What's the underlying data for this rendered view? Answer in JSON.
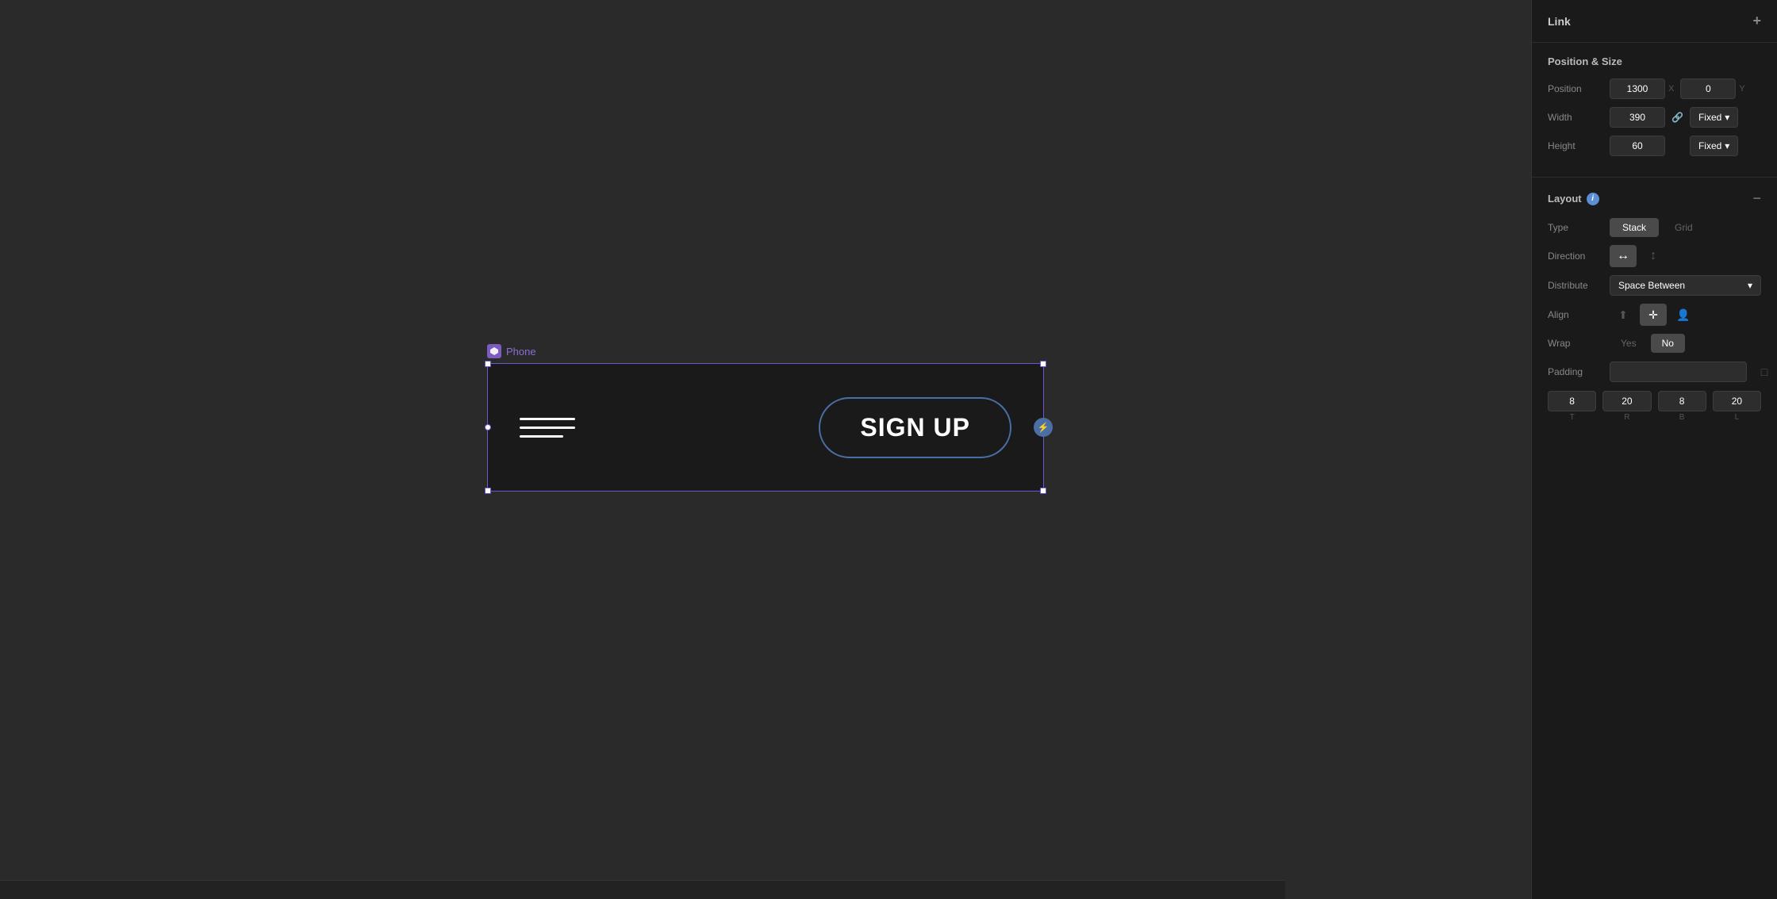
{
  "panel": {
    "link_label": "Link",
    "plus_icon": "+",
    "position_size": {
      "title": "Position & Size",
      "position_label": "Position",
      "position_x_value": "1300",
      "position_x_suffix": "X",
      "position_y_value": "0",
      "position_y_suffix": "Y",
      "width_label": "Width",
      "width_value": "390",
      "width_constraint": "Fixed",
      "height_label": "Height",
      "height_value": "60",
      "height_constraint": "Fixed"
    },
    "layout": {
      "title": "Layout",
      "minus_icon": "−",
      "type_label": "Type",
      "stack_label": "Stack",
      "grid_label": "Grid",
      "direction_label": "Direction",
      "distribute_label": "Distribute",
      "distribute_value": "Space Between",
      "align_label": "Align",
      "wrap_label": "Wrap",
      "wrap_yes": "Yes",
      "wrap_no": "No",
      "padding_label": "Padding",
      "padding_values": {
        "top": "8",
        "top_label": "T",
        "right": "20",
        "right_label": "R",
        "bottom": "8",
        "bottom_label": "B",
        "left": "20",
        "left_label": "L"
      }
    }
  },
  "canvas": {
    "frame_label": "Phone",
    "signup_text": "SIGN UP"
  }
}
